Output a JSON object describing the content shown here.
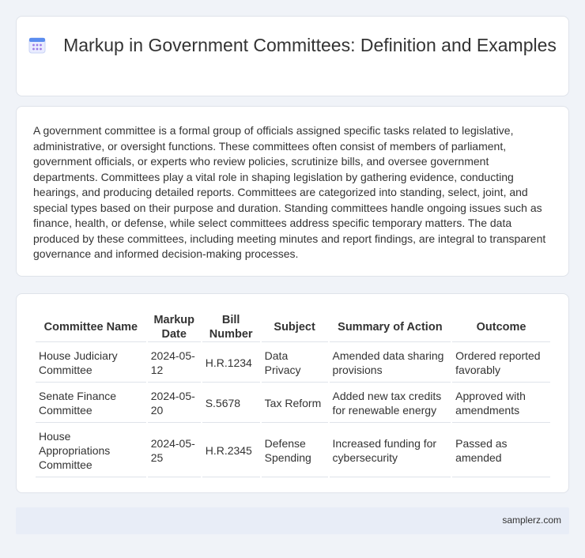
{
  "header": {
    "title": "Markup in Government Committees: Definition and Examples",
    "icon": "calendar-icon",
    "icon_colors": {
      "top": "#5b8def",
      "body": "#e9ecff",
      "dots": "#9b7ae6"
    }
  },
  "description": {
    "text": "A government committee is a formal group of officials assigned specific tasks related to legislative, administrative, or oversight functions. These committees often consist of members of parliament, government officials, or experts who review policies, scrutinize bills, and oversee government departments. Committees play a vital role in shaping legislation by gathering evidence, conducting hearings, and producing detailed reports. Committees are categorized into standing, select, joint, and special types based on their purpose and duration. Standing committees handle ongoing issues such as finance, health, or defense, while select committees address specific temporary matters. The data produced by these committees, including meeting minutes and report findings, are integral to transparent governance and informed decision-making processes."
  },
  "table": {
    "headers": [
      "Committee Name",
      "Markup Date",
      "Bill Number",
      "Subject",
      "Summary of Action",
      "Outcome"
    ],
    "rows": [
      [
        "House Judiciary Committee",
        "2024-05-12",
        "H.R.1234",
        "Data Privacy",
        "Amended data sharing provisions",
        "Ordered reported favorably"
      ],
      [
        "Senate Finance Committee",
        "2024-05-20",
        "S.5678",
        "Tax Reform",
        "Added new tax credits for renewable energy",
        "Approved with amendments"
      ],
      [
        "House Appropriations Committee",
        "2024-05-25",
        "H.R.2345",
        "Defense Spending",
        "Increased funding for cybersecurity",
        "Passed as amended"
      ]
    ]
  },
  "footer": {
    "link": "samplerz.com"
  }
}
